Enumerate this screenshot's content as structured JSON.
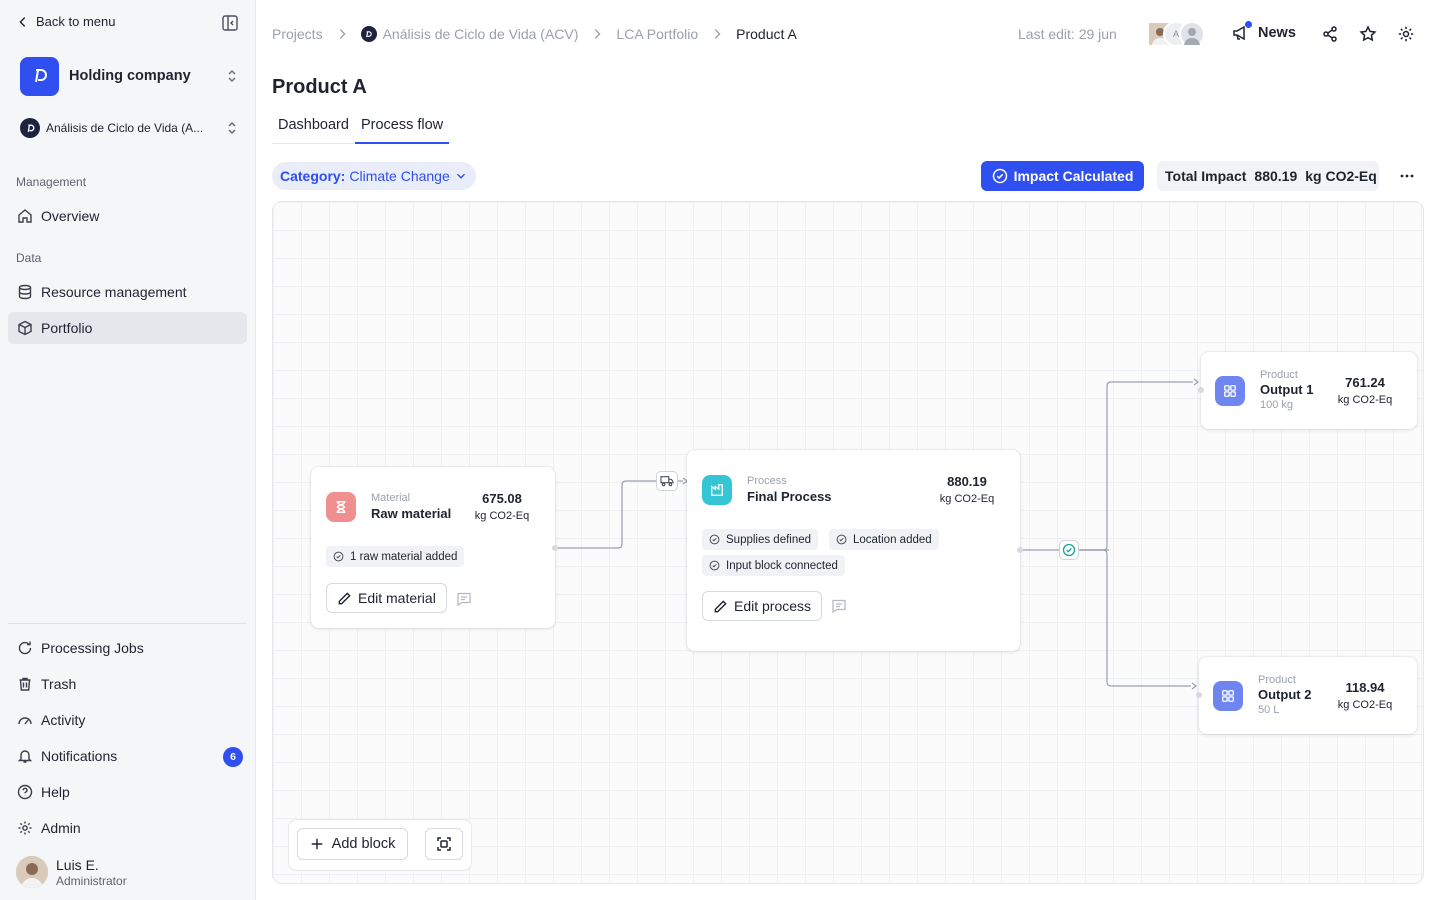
{
  "sidebar": {
    "back_label": "Back to menu",
    "org_name": "Holding company",
    "project_name": "Análisis de Ciclo de Vida (A...",
    "sections": {
      "management": "Management",
      "data": "Data"
    },
    "items": {
      "overview": "Overview",
      "resource_management": "Resource management",
      "portfolio": "Portfolio",
      "processing_jobs": "Processing Jobs",
      "trash": "Trash",
      "activity": "Activity",
      "notifications": "Notifications",
      "notifications_count": "6",
      "help": "Help",
      "admin": "Admin"
    },
    "user": {
      "name": "Luis E.",
      "role": "Administrator"
    }
  },
  "header": {
    "breadcrumbs": [
      "Projects",
      "Análisis de Ciclo de Vida (ACV)",
      "LCA Portfolio",
      "Product A"
    ],
    "last_edit": "Last edit: 29 jun",
    "avatar_initial": "A",
    "news_label": "News"
  },
  "page": {
    "title": "Product A",
    "tabs": [
      "Dashboard",
      "Process flow"
    ],
    "active_tab": "Process flow",
    "category_label": "Category:",
    "category_value": "Climate Change",
    "impact_button": "Impact Calculated",
    "total_label": "Total Impact",
    "total_value": "880.19",
    "total_unit": "kg CO2-Eq"
  },
  "flow": {
    "material": {
      "type": "Material",
      "title": "Raw material",
      "value": "675.08",
      "unit": "kg CO2-Eq",
      "chips": [
        "1 raw material added"
      ],
      "edit_label": "Edit material"
    },
    "process": {
      "type": "Process",
      "title": "Final Process",
      "value": "880.19",
      "unit": "kg CO2-Eq",
      "chips": [
        "Supplies defined",
        "Location added",
        "Input block connected"
      ],
      "edit_label": "Edit process"
    },
    "output1": {
      "type": "Product",
      "title": "Output 1",
      "quantity": "100 kg",
      "value": "761.24",
      "unit": "kg CO2-Eq"
    },
    "output2": {
      "type": "Product",
      "title": "Output 2",
      "quantity": "50 L",
      "value": "118.94",
      "unit": "kg CO2-Eq"
    }
  },
  "toolbar": {
    "add_block_label": "Add block"
  },
  "colors": {
    "accent": "#2f4ff0",
    "material_icon": "#f08f8f",
    "process_icon": "#35c6d6",
    "product_icon": "#6f86f0",
    "success": "#1aa39a"
  }
}
